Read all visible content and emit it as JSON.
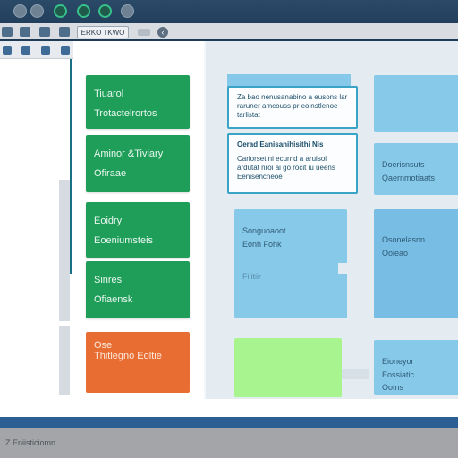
{
  "window": {
    "title_buttons": [
      "gray",
      "gray",
      "green",
      "green",
      "green",
      "gray"
    ]
  },
  "toolbar": {
    "address_text": "ERKO TKWO",
    "chevron": "‹",
    "icons": [
      "panel-icon",
      "back-icon",
      "forward-icon",
      "search-icon"
    ]
  },
  "left_pane": {
    "tab_icons": [
      "grid-icon",
      "doc-icon",
      "settings-icon"
    ]
  },
  "board": {
    "columns": [
      {
        "name": "column-1",
        "cards": [
          {
            "line1": "Tiuarol",
            "line2": "Trotactelrortos",
            "color": "#1f9e5a"
          },
          {
            "line1": "Aminor &Tiviary",
            "line2": "Ofiraae",
            "color": "#1f9e5a"
          },
          {
            "line1": "Eoidry",
            "line2": "Eoeniumsteis",
            "color": "#1f9e5a"
          },
          {
            "line1": "Sinres",
            "line2": "Ofiaensk",
            "color": "#1f9e5a"
          },
          {
            "line1": "Ose",
            "line2": "Thitlegno Eoltie",
            "color": "#e86d33"
          }
        ]
      },
      {
        "name": "column-2",
        "notes": [
          {
            "line1": "Za bao nenusanabino a eusons lar",
            "line2": "raruner amcouss pr eoinstlenoe",
            "line3": "tarlistat"
          },
          {
            "head": "Oerad Eanisanihisithi Nis",
            "line1": "Cariorset ni ecurnd a aruisoi",
            "line2": "ardutat nroi ai go rocit iu ueens",
            "line3": "Eenisencneoe"
          }
        ],
        "cards": [
          {
            "line1": "Songuoaoot",
            "line2": "Eonh Fohk",
            "line3": "Fiiitiir"
          }
        ]
      },
      {
        "name": "column-3",
        "cards": [
          {
            "line1": "",
            "line2": ""
          },
          {
            "line1": "Doerisnsuts",
            "line2": "Qaernmotiaats"
          },
          {
            "line1": "Osonelasnn",
            "line2": "Ooieao"
          },
          {
            "line1": "Eioneyor",
            "line2": "Eossiatic",
            "line3": "Ootns"
          }
        ]
      }
    ]
  },
  "status": {
    "text": "Z Eniisticiomn"
  },
  "colors": {
    "accent_green": "#1f9e5a",
    "accent_orange": "#e86d33",
    "accent_blue": "#87c9e9",
    "accent_lime": "#a8f48e",
    "chrome_dark": "#24425f"
  }
}
